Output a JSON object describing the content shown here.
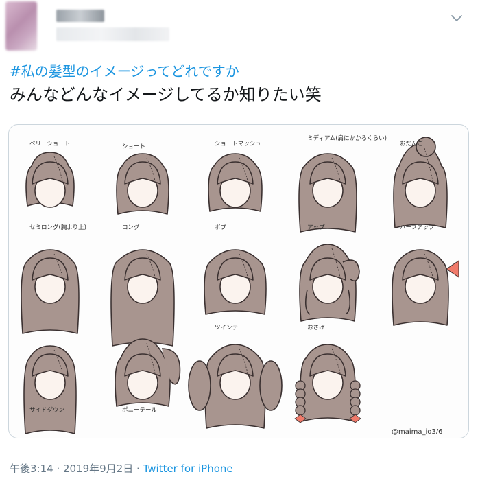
{
  "tweet": {
    "hashtag": "#私の髪型のイメージってどれですか",
    "text": "みんなどんなイメージしてるか知りたい笑",
    "time": "午後3:14",
    "separator": " · ",
    "date": "2019年9月2日",
    "source": "Twitter for iPhone"
  },
  "media": {
    "credit": "@maima_io3/6",
    "hairstyles": [
      {
        "label": "ベリーショート"
      },
      {
        "label": "ショート"
      },
      {
        "label": "ショートマッシュ"
      },
      {
        "label": "ミディアム(肩にかかるくらい)"
      },
      {
        "label": "おだんご"
      },
      {
        "label": "セミロング(胸より上)"
      },
      {
        "label": "ロング"
      },
      {
        "label": "ボブ"
      },
      {
        "label": "アップ"
      },
      {
        "label": "ハーフアップ"
      },
      {
        "label": "サイドダウン"
      },
      {
        "label": "ポニーテール"
      },
      {
        "label": "ツインテ"
      },
      {
        "label": "おさげ"
      }
    ]
  },
  "colors": {
    "hair": "#a8958f",
    "hair_outline": "#3a3030",
    "face": "#fbf3ee",
    "ribbon": "#f07a6a",
    "link": "#1b95e0",
    "meta_text": "#657786"
  },
  "icons": {
    "menu": "chevron-down-icon"
  }
}
